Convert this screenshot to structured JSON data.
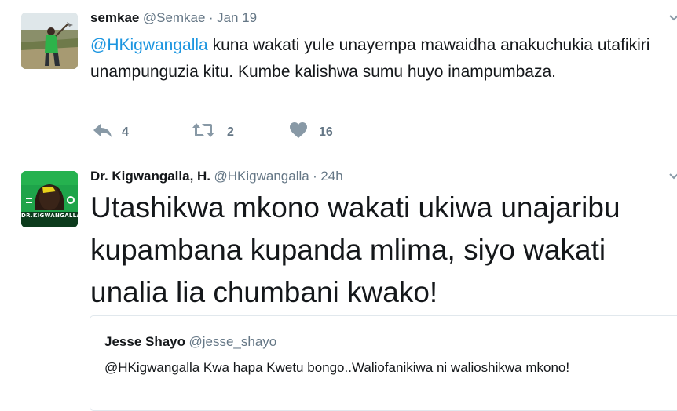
{
  "tweets": [
    {
      "fullname": "semkae",
      "username": "@Semkae",
      "dot": "·",
      "time": "Jan 19",
      "mention": "@HKigwangalla",
      "text": " kuna wakati yule unayempa mawaidha anakuchukia utafikiri unampunguzia kitu. Kumbe kalishwa sumu huyo inampumbaza.",
      "reply_count": "4",
      "retweet_count": "2",
      "like_count": "16"
    },
    {
      "fullname": "Dr. Kigwangalla, H.",
      "username": "@HKigwangalla",
      "dot": "·",
      "time": "24h",
      "text": "Utashikwa mkono wakati ukiwa unajaribu kupambana kupanda mlima, siyo wakati unalia lia chumbani kwako!",
      "avatar_text": "DR.KIGWANGALLA",
      "quote": {
        "fullname": "Jesse Shayo",
        "username": "@jesse_shayo",
        "text": "@HKigwangalla Kwa hapa Kwetu bongo..Waliofanikiwa ni walioshikwa mkono!"
      }
    }
  ],
  "icons": {
    "reply": "reply-icon",
    "retweet": "retweet-icon",
    "like": "heart-icon",
    "more": "chevron-down-icon"
  },
  "colors": {
    "link": "#1b95e0",
    "secondary_text": "#657786",
    "icon": "#8899a6",
    "border": "#e1e8ed"
  }
}
